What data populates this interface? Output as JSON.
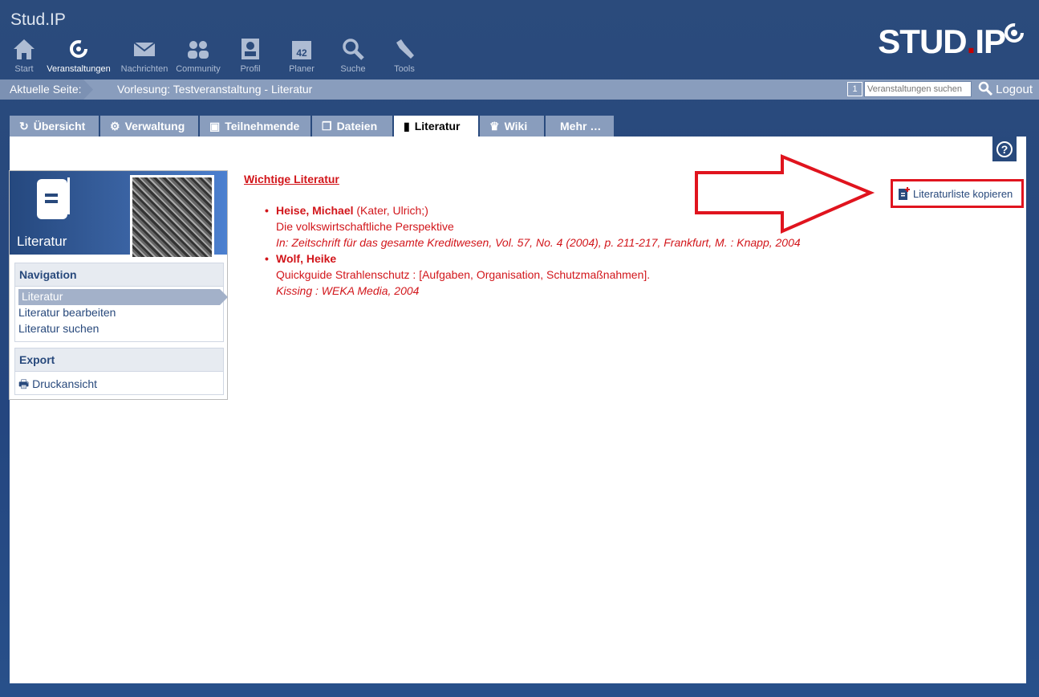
{
  "header": {
    "brand": "Stud.IP",
    "logo": "STUD.IP",
    "nav": [
      {
        "label": "Start",
        "icon": "home-icon"
      },
      {
        "label": "Veranstaltungen",
        "icon": "courses-icon",
        "active": true
      },
      {
        "label": "Nachrichten",
        "icon": "mail-icon"
      },
      {
        "label": "Community",
        "icon": "community-icon"
      },
      {
        "label": "Profil",
        "icon": "profile-icon"
      },
      {
        "label": "Planer",
        "icon": "calendar-icon",
        "badge": "42"
      },
      {
        "label": "Suche",
        "icon": "search-icon"
      },
      {
        "label": "Tools",
        "icon": "wrench-icon"
      }
    ]
  },
  "breadcrumb": {
    "label": "Aktuelle Seite:",
    "path": "Vorlesung: Testveranstaltung - Literatur"
  },
  "topbar": {
    "counter": "1",
    "search_placeholder": "Veranstaltungen suchen",
    "logout": "Logout"
  },
  "tabs": [
    {
      "label": "Übersicht"
    },
    {
      "label": "Verwaltung"
    },
    {
      "label": "Teilnehmende"
    },
    {
      "label": "Dateien"
    },
    {
      "label": "Literatur",
      "active": true
    },
    {
      "label": "Wiki"
    },
    {
      "label": "Mehr …"
    }
  ],
  "sidebar": {
    "title": "Literatur",
    "nav_title": "Navigation",
    "nav_items": [
      "Literatur",
      "Literatur bearbeiten",
      "Literatur suchen"
    ],
    "export_title": "Export",
    "export_items": [
      "Druckansicht"
    ]
  },
  "literature": {
    "heading": "Wichtige Literatur",
    "entries": [
      {
        "author": "Heise, Michael",
        "coauthors": " (Kater, Ulrich;)",
        "title": "Die volkswirtschaftliche Perspektive",
        "source": "In: Zeitschrift für das gesamte Kreditwesen, Vol. 57, No. 4 (2004), p. 211-217, Frankfurt, M. : Knapp, 2004"
      },
      {
        "author": "Wolf, Heike",
        "coauthors": "",
        "title": "Quickguide Strahlenschutz : [Aufgaben, Organisation, Schutzmaßnahmen].",
        "source": "Kissing : WEKA Media, 2004"
      }
    ]
  },
  "actions": {
    "copy_list": "Literaturliste kopieren"
  },
  "colors": {
    "primary": "#28497c",
    "accent": "#d2161b",
    "annotation": "#e0141e"
  }
}
